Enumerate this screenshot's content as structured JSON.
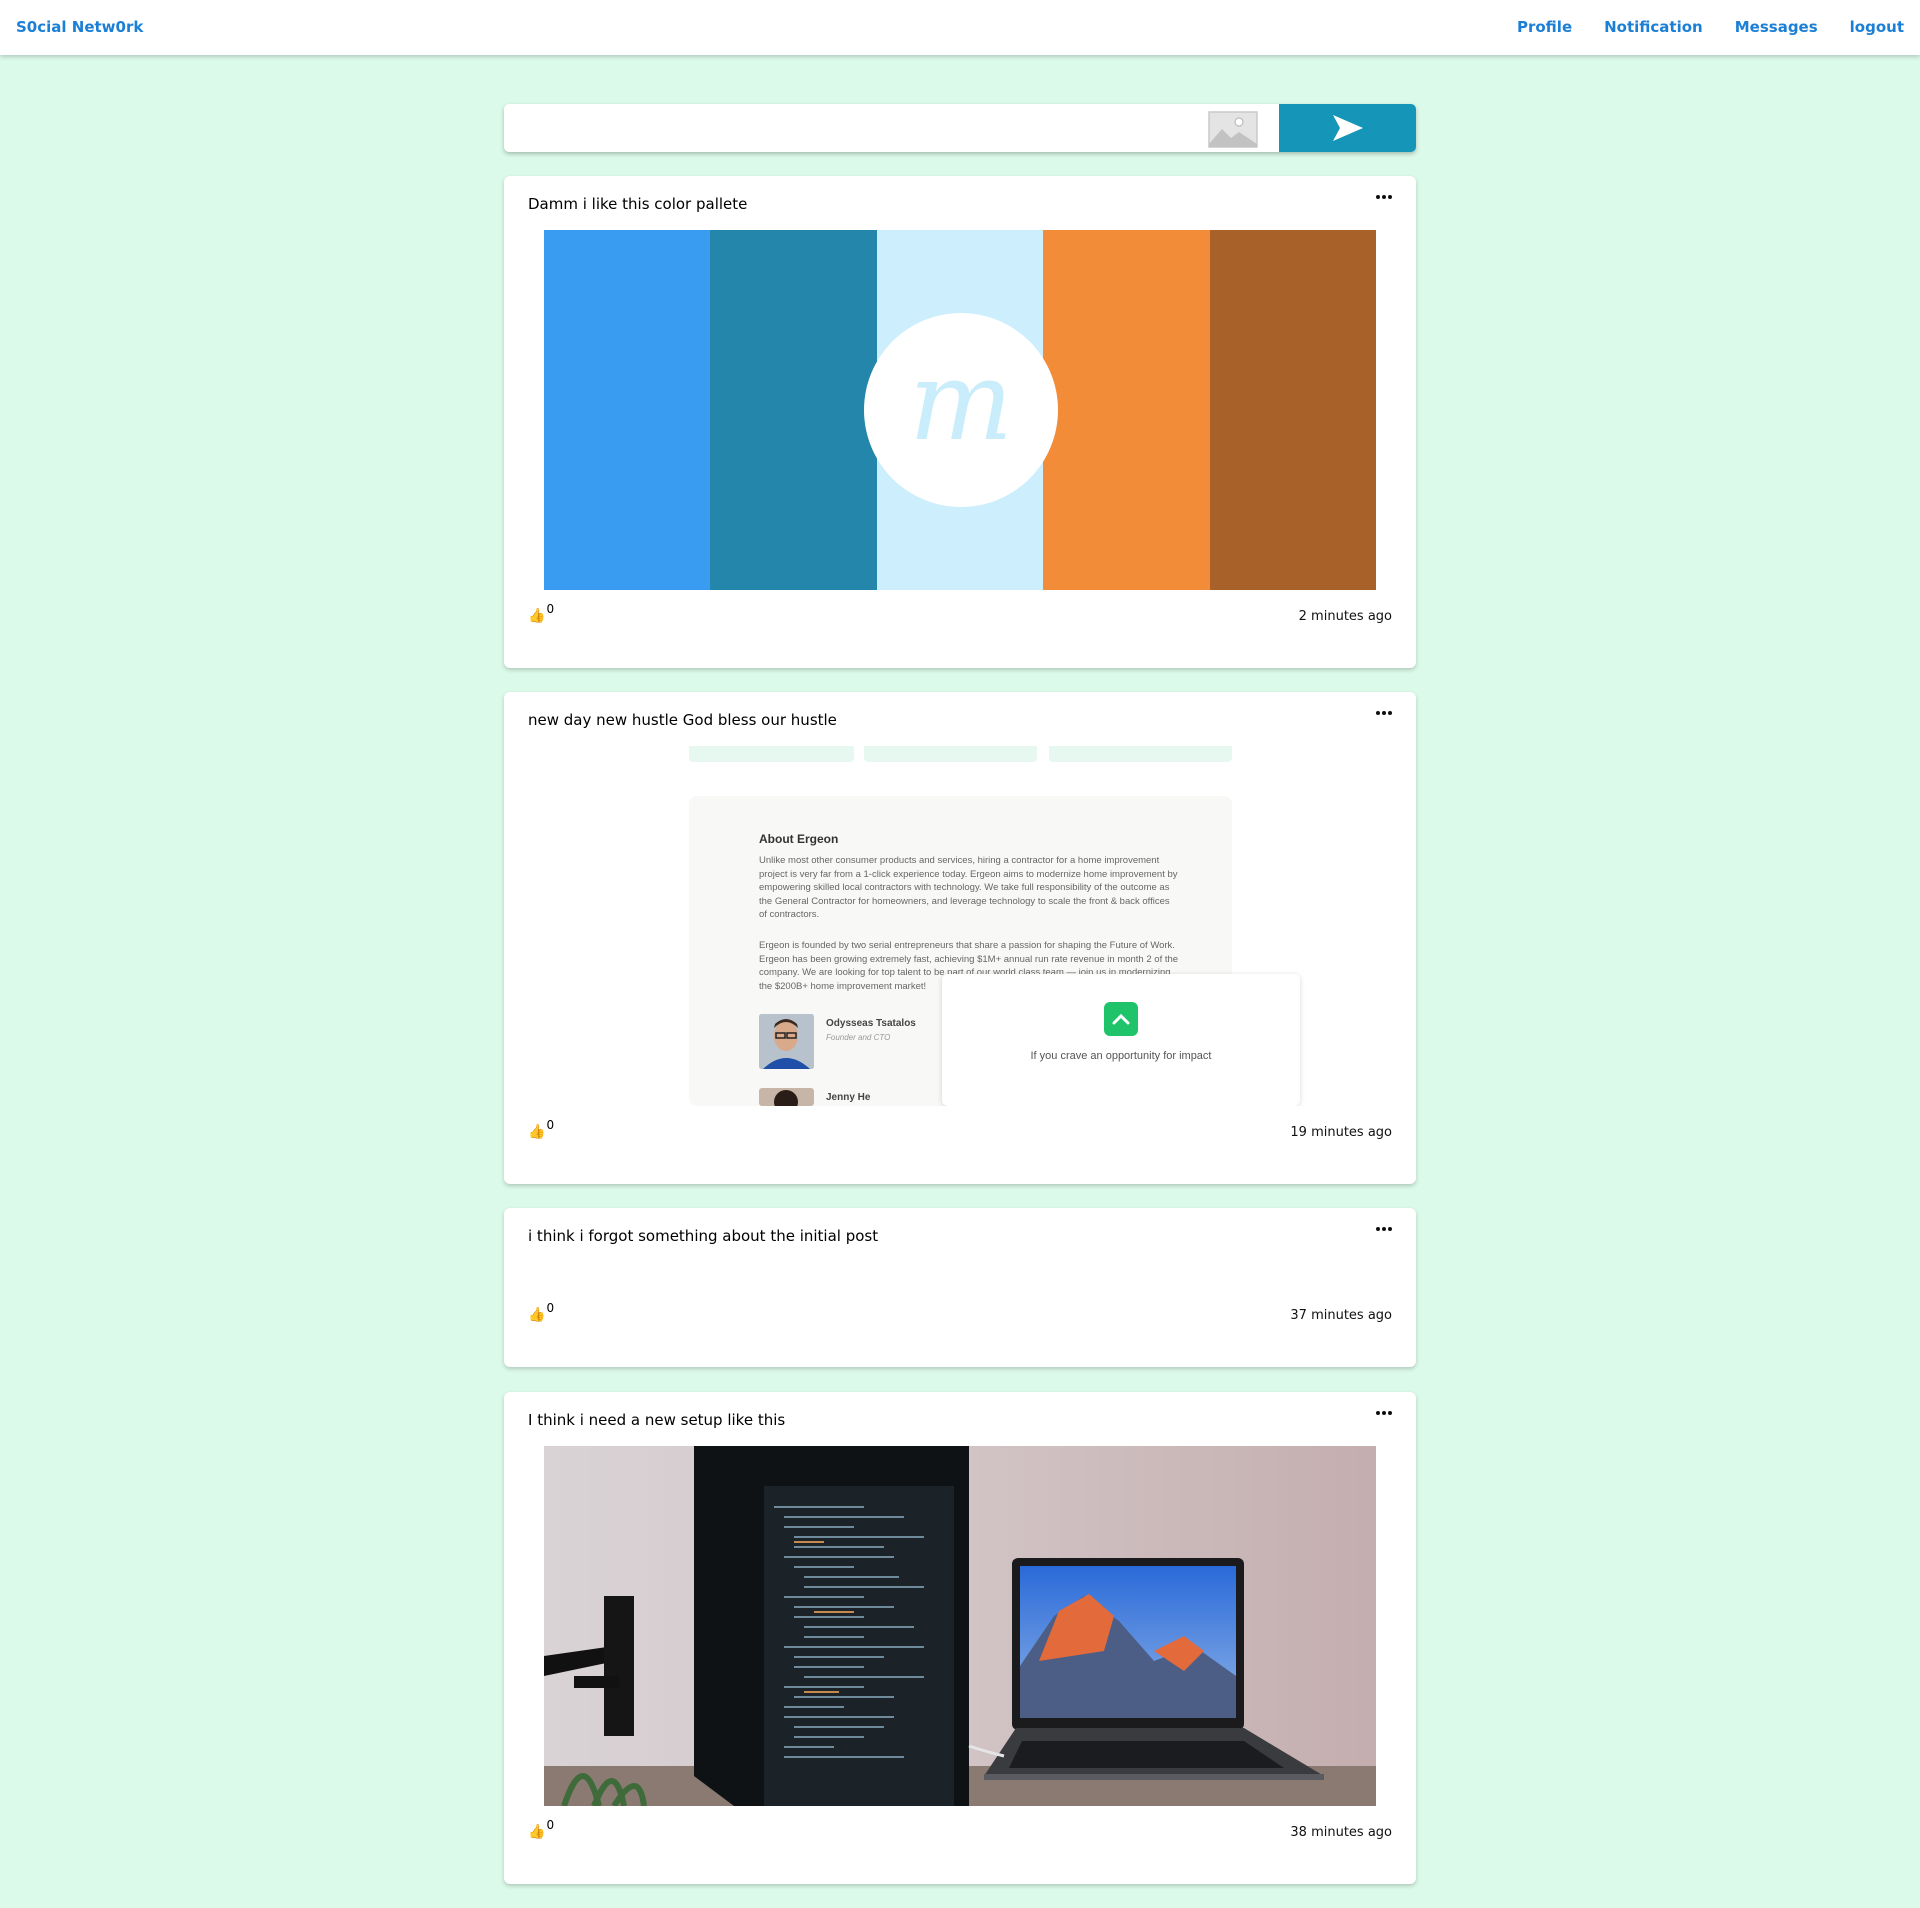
{
  "nav": {
    "brand": "S0cial Netw0rk",
    "links": [
      "Profile",
      "Notification",
      "Messages",
      "logout"
    ]
  },
  "composer": {
    "placeholder": "",
    "image_icon": "image-icon",
    "send_icon": "send-arrow-icon"
  },
  "posts": [
    {
      "text": "Damm i like this color pallete",
      "likes": "0",
      "time": "2 minutes ago",
      "image": {
        "kind": "color-palette",
        "colors": [
          "#3a9cf0",
          "#2386aa",
          "#cdeefc",
          "#f28c38",
          "#a86128"
        ],
        "logo_letter": "m"
      }
    },
    {
      "text": "new day new hustle God bless our hustle",
      "likes": "0",
      "time": "19 minutes ago",
      "image": {
        "kind": "screenshot",
        "heading": "About Ergeon",
        "paragraph1": "Unlike most other consumer products and services, hiring a contractor for a home improvement project is very far from a 1-click experience today.  Ergeon aims to modernize home improvement by empowering skilled local contractors with technology. We take full responsibility of the outcome as the General Contractor for homeowners, and leverage technology to scale the front & back offices of contractors.",
        "paragraph2": "Ergeon is founded by two serial entrepreneurs that share a passion for shaping the Future of Work.  Ergeon has been growing extremely fast, achieving $1M+ annual run rate revenue in month 2 of the company. We are looking for top talent to be part of our world class team — join us in modernizing  the $200B+ home improvement market!",
        "person1_name": "Odysseas Tsatalos",
        "person1_role": "Founder and CTO",
        "person2_name": "Jenny He",
        "popup_text": "If you crave an opportunity for impact"
      }
    },
    {
      "text": "i think i forgot something about the initial post",
      "likes": "0",
      "time": "37 minutes ago"
    },
    {
      "text": "I think i need a new setup like this",
      "likes": "0",
      "time": "38 minutes ago",
      "image": {
        "kind": "photo",
        "subject": "monitor and laptop desk setup"
      }
    }
  ]
}
